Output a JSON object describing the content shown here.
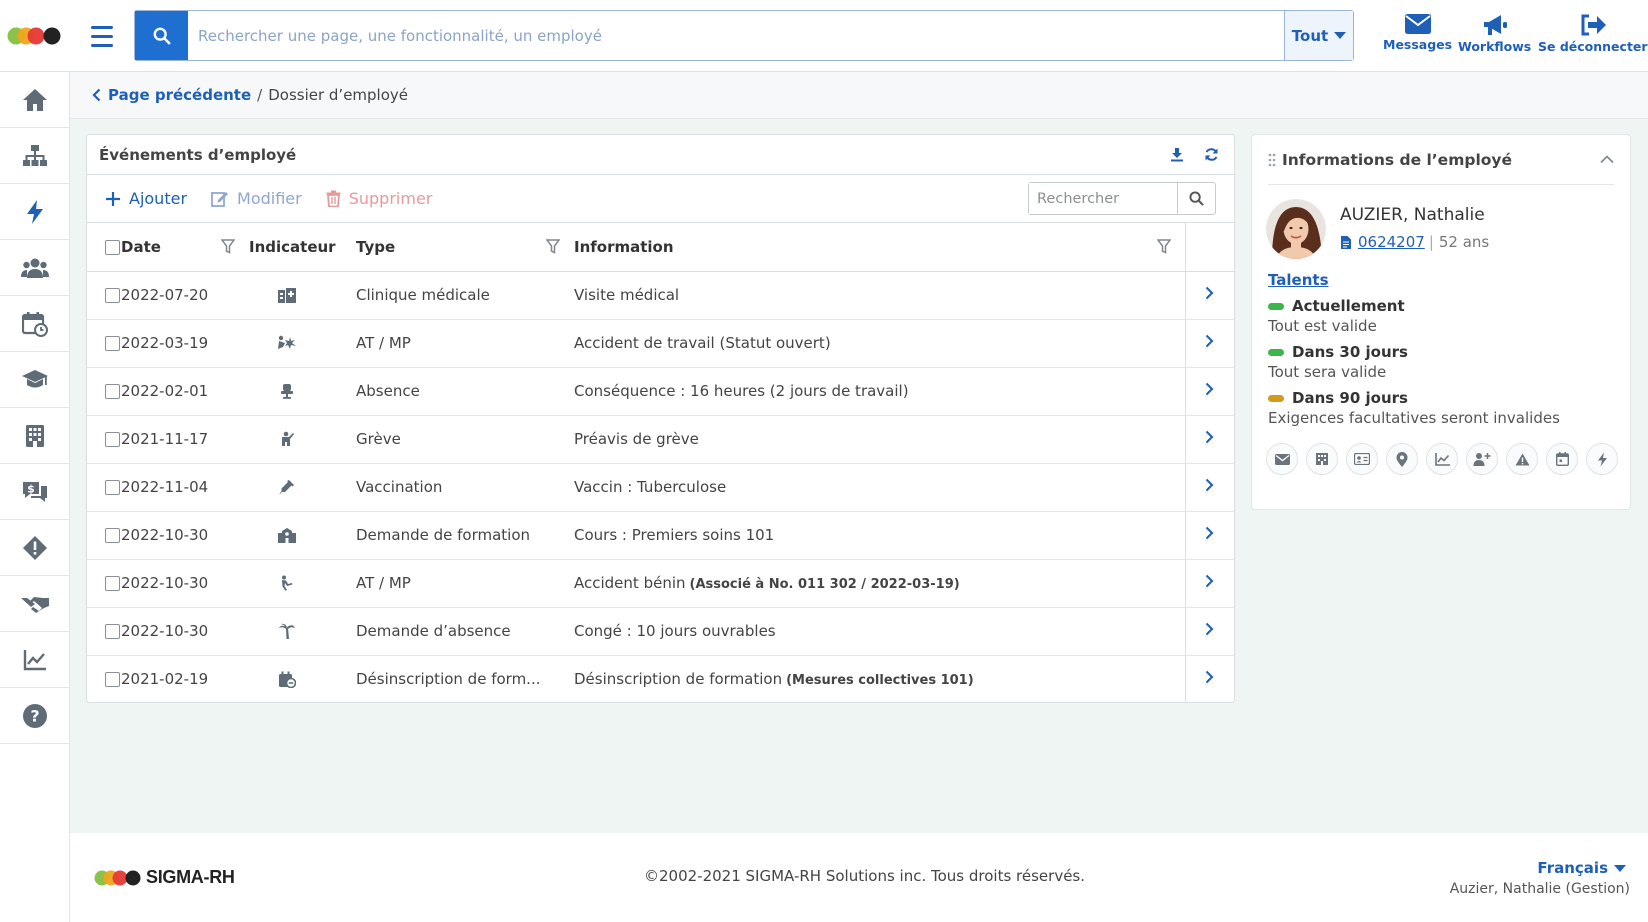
{
  "topbar": {
    "search_placeholder": "Rechercher une page, une fonctionnalité, un employé",
    "scope_label": "Tout",
    "actions": {
      "messages": "Messages",
      "workflows": "Workflows",
      "logout": "Se déconnecter"
    }
  },
  "sidebar": {
    "items": [
      "home-icon",
      "org-chart-icon",
      "events-bolt-icon",
      "team-icon",
      "calendar-clock-icon",
      "graduation-cap-icon",
      "building-icon",
      "salary-icon",
      "warning-icon",
      "handshake-icon",
      "chart-icon",
      "help-icon"
    ],
    "active_index": 2
  },
  "breadcrumb": {
    "back_label": "Page précédente",
    "separator": "/",
    "current": "Dossier d’employé"
  },
  "events": {
    "title": "Événements d’employé",
    "toolbar": {
      "add": "Ajouter",
      "edit": "Modifier",
      "delete": "Supprimer",
      "search_placeholder": "Rechercher"
    },
    "columns": {
      "date": "Date",
      "indicator": "Indicateur",
      "type": "Type",
      "information": "Information"
    },
    "rows": [
      {
        "date": "2022-07-20",
        "indicator": "clinic-icon",
        "type": "Clinique médicale",
        "info": "Visite médical",
        "info_extra": ""
      },
      {
        "date": "2022-03-19",
        "indicator": "accident-icon",
        "type": "AT / MP",
        "info": "Accident de travail (Statut ouvert)",
        "info_extra": ""
      },
      {
        "date": "2022-02-01",
        "indicator": "empty-chair-icon",
        "type": "Absence",
        "info": "Conséquence : 16 heures (2 jours de travail)",
        "info_extra": ""
      },
      {
        "date": "2021-11-17",
        "indicator": "strike-icon",
        "type": "Grève",
        "info": "Préavis de grève",
        "info_extra": ""
      },
      {
        "date": "2022-11-04",
        "indicator": "syringe-icon",
        "type": "Vaccination",
        "info": "Vaccin : Tuberculose",
        "info_extra": ""
      },
      {
        "date": "2022-10-30",
        "indicator": "school-icon",
        "type": "Demande de formation",
        "info": "Cours : Premiers soins 101",
        "info_extra": ""
      },
      {
        "date": "2022-10-30",
        "indicator": "falling-person-icon",
        "type": "AT / MP",
        "info": "Accident bénin",
        "info_extra": "(Associé à No. 011 302 / 2022-03-19)"
      },
      {
        "date": "2022-10-30",
        "indicator": "palm-tree-icon",
        "type": "Demande d’absence",
        "info": "Congé : 10 jours ouvrables",
        "info_extra": ""
      },
      {
        "date": "2021-02-19",
        "indicator": "calendar-remove-icon",
        "type": "Désinscription de form...",
        "info": "Désinscription de formation",
        "info_extra": "(Mesures collectives 101)"
      }
    ]
  },
  "employee": {
    "panel_title": "Informations de l’employé",
    "name": "AUZIER, Nathalie",
    "employee_id": "0624207",
    "meta_sep": "|",
    "age": "52 ans",
    "talents_label": "Talents",
    "talents": [
      {
        "title": "Actuellement",
        "desc": "Tout est valide",
        "color": "#3cb64a"
      },
      {
        "title": "Dans 30 jours",
        "desc": "Tout sera valide",
        "color": "#3cb64a"
      },
      {
        "title": "Dans 90 jours",
        "desc": "Exigences facultatives seront invalides",
        "color": "#d39a1e"
      }
    ],
    "quick_icons": [
      "mail-icon",
      "building-icon",
      "id-card-icon",
      "location-icon",
      "chart-icon",
      "user-plus-icon",
      "warning-icon",
      "calendar-icon",
      "bolt-icon"
    ]
  },
  "footer": {
    "brand": "SIGMA-RH",
    "copyright": "©2002-2021 SIGMA-RH Solutions inc. Tous droits réservés.",
    "language": "Français",
    "user": "Auzier, Nathalie (Gestion)"
  },
  "colors": {
    "accent": "#1f5fb8",
    "search_button": "#1f6fd1",
    "background": "#eef5f3"
  }
}
